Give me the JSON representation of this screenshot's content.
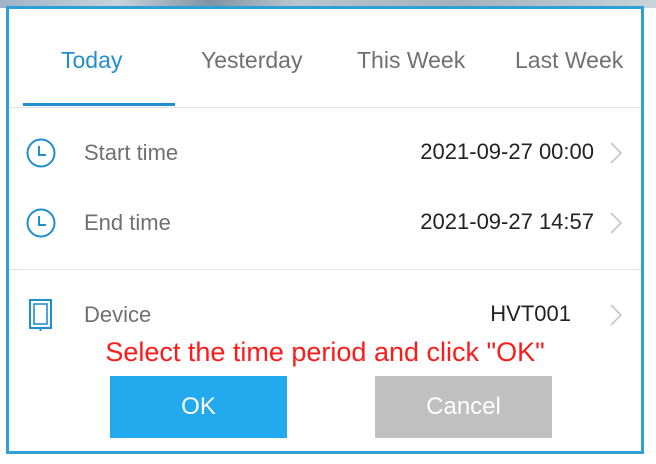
{
  "tabs": [
    {
      "label": "Today",
      "active": true
    },
    {
      "label": "Yesterday",
      "active": false
    },
    {
      "label": "This Week",
      "active": false
    },
    {
      "label": "Last Week",
      "active": false
    }
  ],
  "fields": {
    "start": {
      "label": "Start time",
      "value": "2021-09-27 00:00",
      "icon": "clock-icon"
    },
    "end": {
      "label": "End time",
      "value": "2021-09-27 14:57",
      "icon": "clock-icon"
    },
    "device": {
      "label": "Device",
      "value": "HVT001",
      "icon": "device-icon"
    }
  },
  "instruction": "Select the time period and click \"OK\"",
  "buttons": {
    "ok": "OK",
    "cancel": "Cancel"
  },
  "colors": {
    "accent": "#1f8fd0",
    "frame": "#2f9fd8",
    "ok_button": "#22a9ee",
    "cancel_button": "#c0c0c0",
    "instruction": "#ff1a1a"
  }
}
